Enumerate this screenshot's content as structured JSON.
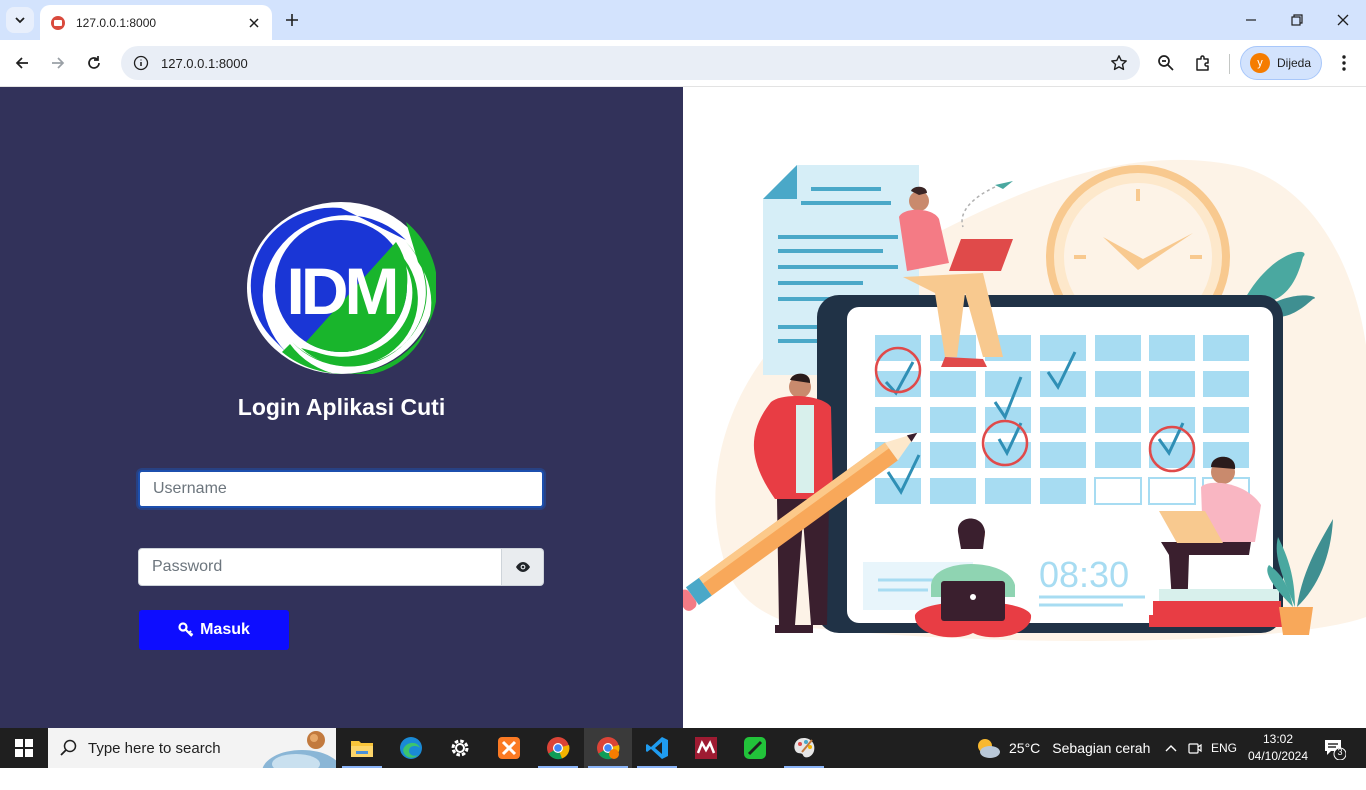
{
  "browser": {
    "tab_title": "127.0.0.1:8000",
    "url": "127.0.0.1:8000",
    "profile_initial": "y",
    "profile_name": "Dijeda"
  },
  "login": {
    "logo_text": "IDM",
    "title": "Login Aplikasi Cuti",
    "username_placeholder": "Username",
    "password_placeholder": "Password",
    "submit_label": "Masuk"
  },
  "illustration": {
    "clock_display": "08:30"
  },
  "taskbar": {
    "search_placeholder": "Type here to search",
    "temperature": "25°C",
    "weather_condition": "Sebagian cerah",
    "language": "ENG",
    "time": "13:02",
    "date": "04/10/2024",
    "notification_count": "3",
    "apps": [
      "file-explorer",
      "edge",
      "settings",
      "xampp",
      "chrome",
      "chrome-profile",
      "vscode",
      "mendeley",
      "line",
      "paint"
    ]
  },
  "colors": {
    "login_panel_bg": "#32325a",
    "login_button": "#0d0dff",
    "logo_blue": "#1a36d6",
    "logo_green": "#19b52c"
  }
}
